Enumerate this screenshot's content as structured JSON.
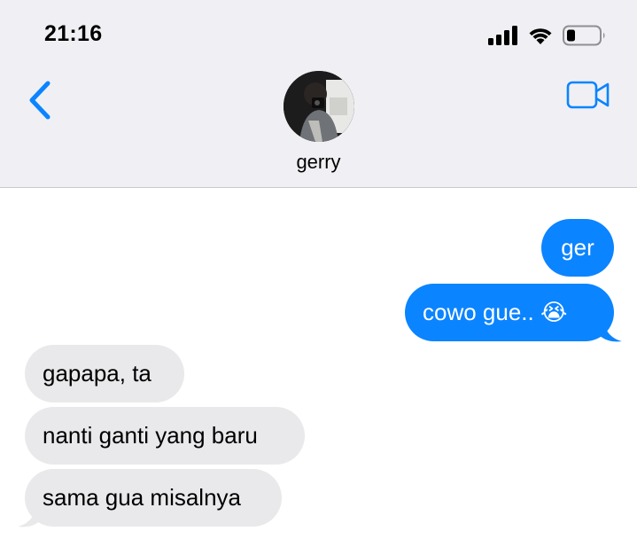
{
  "status_bar": {
    "time": "21:16",
    "icons": [
      "cellular-signal-icon",
      "wifi-icon",
      "battery-icon"
    ]
  },
  "nav": {
    "back_icon": "chevron-left-icon",
    "video_icon": "video-camera-icon",
    "contact_name": "gerry"
  },
  "messages": {
    "m1": "ger",
    "m2": "cowo gue.. 😭",
    "m3": "gapapa, ta",
    "m4": "nanti ganti yang baru",
    "m5": "sama gua misalnya"
  },
  "colors": {
    "accent": "#0b84ff",
    "incoming_bubble": "#e9e9eb",
    "header_bg": "#f0f0f4"
  }
}
